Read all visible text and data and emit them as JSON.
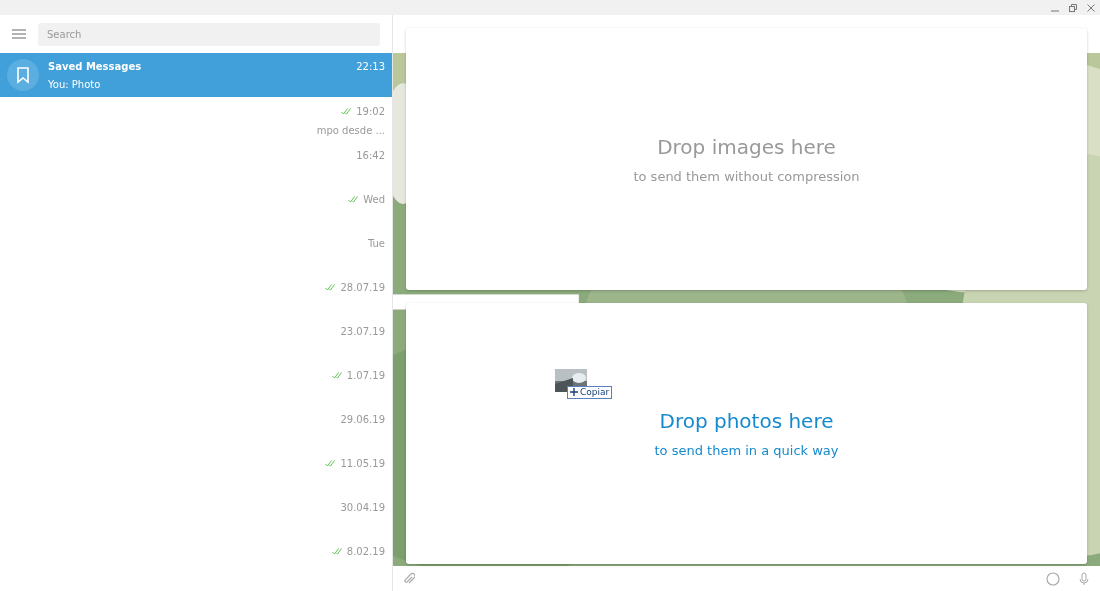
{
  "search": {
    "placeholder": "Search"
  },
  "selected_chat": {
    "name": "Saved Messages",
    "time": "22:13",
    "preview": "You: Photo",
    "selected": true
  },
  "chats": [
    {
      "time": "19:02",
      "sent_read": true,
      "preview": "mpo desde ..."
    },
    {
      "time": "16:42",
      "sent_read": false
    },
    {
      "time": "Wed",
      "sent_read": true
    },
    {
      "time": "Tue",
      "sent_read": false
    },
    {
      "time": "28.07.19",
      "sent_read": true
    },
    {
      "time": "23.07.19",
      "sent_read": false
    },
    {
      "time": "1.07.19",
      "sent_read": true
    },
    {
      "time": "29.06.19",
      "sent_read": false
    },
    {
      "time": "11.05.19",
      "sent_read": true
    },
    {
      "time": "30.04.19",
      "sent_read": false
    },
    {
      "time": "8.02.19",
      "sent_read": true
    }
  ],
  "drop_zones": [
    {
      "title": "Drop images here",
      "subtitle": "to send them without compression",
      "hovered": false
    },
    {
      "title": "Drop photos here",
      "subtitle": "to send them in a quick way",
      "hovered": true
    }
  ],
  "drag_ghost": {
    "action": "Copiar"
  }
}
